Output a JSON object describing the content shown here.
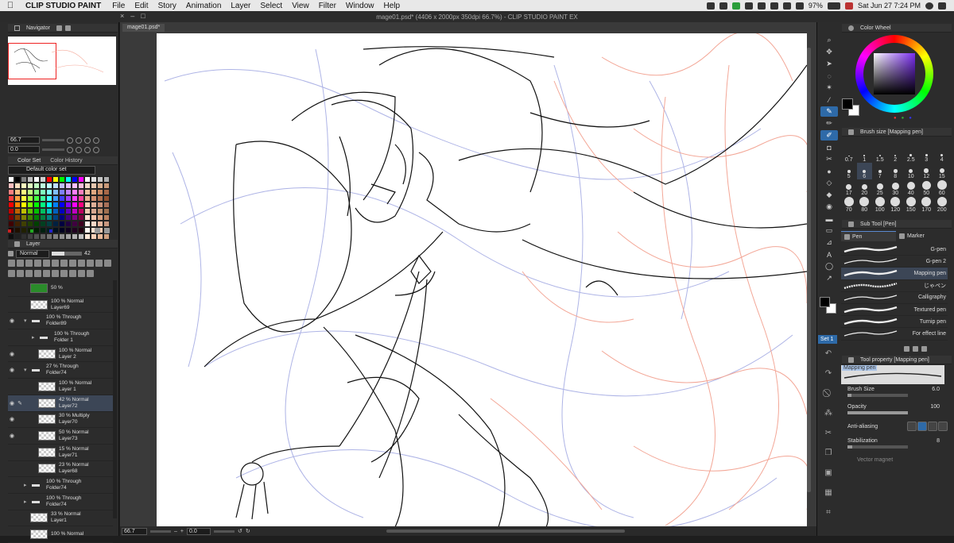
{
  "menubar": {
    "app": "CLIP STUDIO PAINT",
    "items": [
      "File",
      "Edit",
      "Story",
      "Animation",
      "Layer",
      "Select",
      "View",
      "Filter",
      "Window",
      "Help"
    ],
    "battery": "97%",
    "datetime": "Sat Jun 27  7:24 PM"
  },
  "window": {
    "title": "mage01.psd* (4406 x 2000px 350dpi 66.7%)  - CLIP STUDIO PAINT EX",
    "doc_tab": "mage01.psd*"
  },
  "navigator": {
    "tab": "Navigator",
    "zoom": "66.7",
    "angle": "0.0"
  },
  "colorset": {
    "tabs": [
      "Color Set",
      "Color History"
    ],
    "selected": "Default color set",
    "swatches": [
      "#ffffff",
      "#000000",
      "#808080",
      "#c0c0c0",
      "#ffffff",
      "#d0d0d0",
      "#ff0000",
      "#ffff00",
      "#00ff00",
      "#00ffff",
      "#0000ff",
      "#ff00ff",
      "#ffffff",
      "#e0e0e0",
      "#c8c8c8",
      "#b0b0b0",
      "#ffbfbf",
      "#ffdfbf",
      "#ffffbf",
      "#dfffbf",
      "#bfffbf",
      "#bfffdf",
      "#bfffff",
      "#bfdfff",
      "#bfbfff",
      "#dfbfff",
      "#ffbfff",
      "#ffbfdf",
      "#f0d8c8",
      "#e8c8b0",
      "#d8b090",
      "#c89878",
      "#ff8080",
      "#ffbf80",
      "#ffff80",
      "#bfff80",
      "#80ff80",
      "#80ffbf",
      "#80ffff",
      "#80bfff",
      "#8080ff",
      "#bf80ff",
      "#ff80ff",
      "#ff80bf",
      "#f0c0a0",
      "#e0a880",
      "#c88860",
      "#a86848",
      "#ff4040",
      "#ff9f40",
      "#ffff40",
      "#9fff40",
      "#40ff40",
      "#40ff9f",
      "#40ffff",
      "#409fff",
      "#4040ff",
      "#9f40ff",
      "#ff40ff",
      "#ff409f",
      "#e8b090",
      "#d09070",
      "#b07050",
      "#905030",
      "#ff0000",
      "#ff8000",
      "#ffff00",
      "#80ff00",
      "#00ff00",
      "#00ff80",
      "#00ffff",
      "#0080ff",
      "#0000ff",
      "#8000ff",
      "#ff00ff",
      "#ff0080",
      "#f8d0b8",
      "#e0b098",
      "#c89078",
      "#a87058",
      "#c00000",
      "#c06000",
      "#c0c000",
      "#60c000",
      "#00c000",
      "#00c060",
      "#00c0c0",
      "#0060c0",
      "#0000c0",
      "#6000c0",
      "#c000c0",
      "#c00060",
      "#f0c8b0",
      "#d8a890",
      "#c09070",
      "#a07050",
      "#800000",
      "#804000",
      "#808000",
      "#408000",
      "#008000",
      "#008040",
      "#008080",
      "#004080",
      "#000080",
      "#400080",
      "#800080",
      "#800040",
      "#ffe0d0",
      "#f0c0a8",
      "#d8a080",
      "#b88060",
      "#400000",
      "#402000",
      "#404000",
      "#204000",
      "#004000",
      "#004020",
      "#004040",
      "#002040",
      "#000040",
      "#200040",
      "#400040",
      "#400020",
      "#fff0e8",
      "#f8d8c8",
      "#e8b8a0",
      "#c89880",
      "#200000",
      "#201000",
      "#202000",
      "#102000",
      "#002000",
      "#002010",
      "#002020",
      "#001020",
      "#000020",
      "#100020",
      "#200020",
      "#200010",
      "#fff8f0",
      "#f8e0d0",
      "#f0c8b0",
      "#e0a890",
      "#101010",
      "#202020",
      "#303030",
      "#404040",
      "#505050",
      "#606060",
      "#707070",
      "#808080",
      "#909090",
      "#a0a0a0",
      "#b0b0b0",
      "#c0c0c0",
      "#ffe8d8",
      "#f8d0b8",
      "#e8b898",
      "#d0a080"
    ]
  },
  "layer": {
    "tab": "Layer",
    "blend": "Normal",
    "opacity": "42",
    "rows": [
      {
        "text1": "50 %",
        "text2": "",
        "eye": false,
        "kind": "green",
        "indent": 0,
        "fold": ""
      },
      {
        "text1": "100 % Normal",
        "text2": "Layer69",
        "eye": false,
        "kind": "layer",
        "indent": 0,
        "fold": ""
      },
      {
        "text1": "100 % Through",
        "text2": "Folder89",
        "eye": true,
        "kind": "folder",
        "indent": 0,
        "fold": "v"
      },
      {
        "text1": "100 % Through",
        "text2": "Folder 1",
        "eye": false,
        "kind": "folder",
        "indent": 1,
        "fold": ">"
      },
      {
        "text1": "100 % Normal",
        "text2": "Layer 2",
        "eye": true,
        "kind": "layer",
        "indent": 1,
        "fold": ""
      },
      {
        "text1": "27 % Through",
        "text2": "Folder74",
        "eye": true,
        "kind": "folder",
        "indent": 0,
        "fold": "v"
      },
      {
        "text1": "100 % Normal",
        "text2": "Layer 1",
        "eye": false,
        "kind": "layer",
        "indent": 1,
        "fold": ""
      },
      {
        "text1": "42 % Normal",
        "text2": "Layer72",
        "eye": true,
        "kind": "layer",
        "indent": 1,
        "fold": "",
        "sel": true,
        "pen": true
      },
      {
        "text1": "30 % Multiply",
        "text2": "Layer70",
        "eye": true,
        "kind": "layer",
        "indent": 1,
        "fold": ""
      },
      {
        "text1": "50 % Normal",
        "text2": "Layer73",
        "eye": true,
        "kind": "layer",
        "indent": 1,
        "fold": ""
      },
      {
        "text1": "15 % Normal",
        "text2": "Layer71",
        "eye": false,
        "kind": "layer",
        "indent": 1,
        "fold": ""
      },
      {
        "text1": "23 % Normal",
        "text2": "Layer68",
        "eye": false,
        "kind": "layer",
        "indent": 1,
        "fold": ""
      },
      {
        "text1": "100 % Through",
        "text2": "Folder74",
        "eye": false,
        "kind": "folder",
        "indent": 0,
        "fold": ">"
      },
      {
        "text1": "100 % Through",
        "text2": "Folder74",
        "eye": false,
        "kind": "folder",
        "indent": 0,
        "fold": ">"
      },
      {
        "text1": "33 % Normal",
        "text2": "Layer1",
        "eye": false,
        "kind": "layer",
        "indent": 0,
        "fold": ""
      },
      {
        "text1": "100 % Normal",
        "text2": "",
        "eye": false,
        "kind": "layer",
        "indent": 0,
        "fold": ""
      }
    ]
  },
  "canvas_status": {
    "zoom": "66.7",
    "angle": "0.0"
  },
  "color_wheel": {
    "tab": "Color Wheel",
    "hue_color": "#7a2df0"
  },
  "brush_size": {
    "tab": "Brush size [Mapping pen]",
    "sizes": [
      "0.7",
      "1",
      "1.5",
      "2",
      "2.5",
      "3",
      "4",
      "5",
      "6",
      "7",
      "8",
      "10",
      "12",
      "15",
      "17",
      "20",
      "25",
      "30",
      "40",
      "50",
      "60",
      "70",
      "80",
      "100",
      "120",
      "150",
      "170",
      "200"
    ],
    "selected": "6"
  },
  "sub_tool": {
    "tab": "Sub Tool [Pen]",
    "tabs": [
      "Pen",
      "Marker"
    ],
    "pens": [
      "G-pen",
      "G-pen 2",
      "Mapping pen",
      "じゃペン",
      "Calligraphy",
      "Textured pen",
      "Turnip pen",
      "For effect line"
    ],
    "selected": "Mapping pen",
    "set": "Set 1"
  },
  "tool_property": {
    "tab": "Tool property [Mapping pen]",
    "preview_label": "Mapping pen",
    "brush_size_label": "Brush Size",
    "brush_size": "6.0",
    "opacity_label": "Opacity",
    "opacity": "100",
    "aa_label": "Anti-aliasing",
    "stabilization_label": "Stabilization",
    "stabilization": "8",
    "vector_magnet": "Vector magnet"
  }
}
